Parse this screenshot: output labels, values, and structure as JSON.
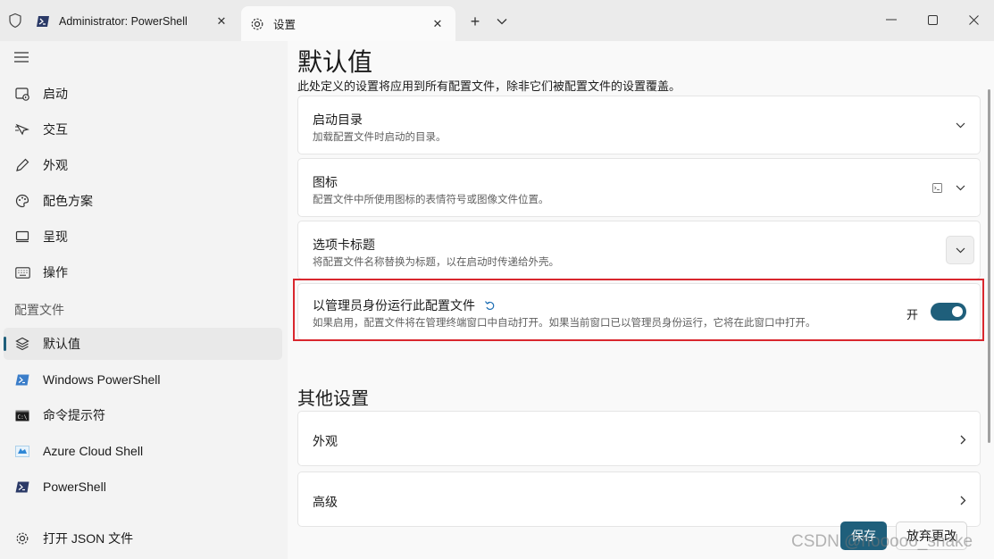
{
  "titlebar": {
    "tabs": [
      {
        "label": "Administrator: PowerShell",
        "icon": "powershell-icon",
        "active": false
      },
      {
        "label": "设置",
        "icon": "gear-icon",
        "active": true
      }
    ],
    "new_tab": "+"
  },
  "sidebar": {
    "items": [
      {
        "label": "启动",
        "icon": "startup-icon"
      },
      {
        "label": "交互",
        "icon": "interaction-icon"
      },
      {
        "label": "外观",
        "icon": "pen-icon"
      },
      {
        "label": "配色方案",
        "icon": "palette-icon"
      },
      {
        "label": "呈现",
        "icon": "monitor-icon"
      },
      {
        "label": "操作",
        "icon": "keyboard-icon"
      }
    ],
    "section_header": "配置文件",
    "profiles": [
      {
        "label": "默认值",
        "icon": "layers-icon",
        "selected": true
      },
      {
        "label": "Windows PowerShell",
        "icon": "powershell-icon"
      },
      {
        "label": "命令提示符",
        "icon": "cmd-icon"
      },
      {
        "label": "Azure Cloud Shell",
        "icon": "azure-icon"
      },
      {
        "label": "PowerShell",
        "icon": "powershell-dark-icon"
      }
    ],
    "open_json": "打开 JSON 文件"
  },
  "main": {
    "title": "默认值",
    "description": "此处定义的设置将应用到所有配置文件，除非它们被配置文件的设置覆盖。",
    "cards": [
      {
        "title": "启动目录",
        "desc": "加载配置文件时启动的目录。"
      },
      {
        "title": "图标",
        "desc": "配置文件中所使用图标的表情符号或图像文件位置。"
      },
      {
        "title": "选项卡标题",
        "desc": "将配置文件名称替换为标题，以在启动时传递给外壳。"
      },
      {
        "title": "以管理员身份运行此配置文件",
        "desc": "如果启用，配置文件将在管理终端窗口中自动打开。如果当前窗口已以管理员身份运行，它将在此窗口中打开。",
        "toggle_label": "开",
        "toggle_on": true
      }
    ],
    "other_header": "其他设置",
    "other_cards": [
      {
        "title": "外观"
      },
      {
        "title": "高级"
      }
    ]
  },
  "footer": {
    "save": "保存",
    "discard": "放弃更改"
  },
  "watermark": "CSDN @hooooo_shake",
  "colors": {
    "accent": "#1f5f7b",
    "highlight": "#d9272e"
  }
}
